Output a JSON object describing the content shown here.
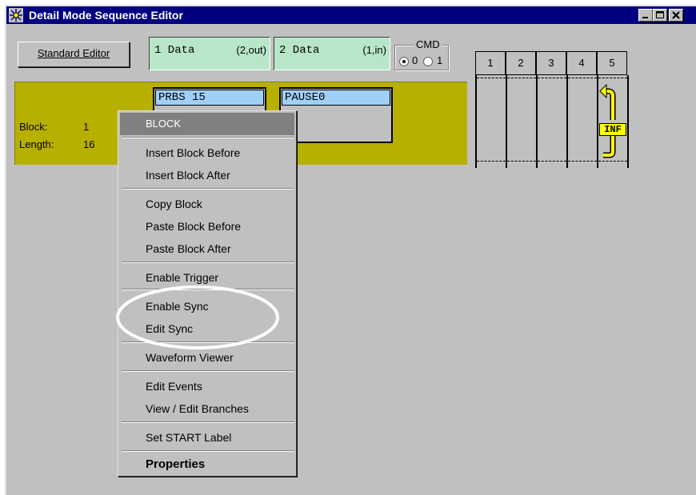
{
  "window": {
    "title": "Detail Mode Sequence Editor",
    "icons": [
      "app-icon",
      "minimize-icon",
      "maximize-icon",
      "close-icon"
    ],
    "colors": {
      "titlebar": "#000080",
      "face": "#c0c0c0"
    }
  },
  "toolbar": {
    "standard_editor_label": "Standard Editor",
    "data1": {
      "name": "1 Data",
      "channel": "(2,out)"
    },
    "data2": {
      "name": "2 Data",
      "channel": "(1,in)"
    },
    "cmd": {
      "legend": "CMD",
      "options": [
        "0",
        "1"
      ],
      "selected": "0"
    }
  },
  "sequence_grid": {
    "columns": [
      "1",
      "2",
      "3",
      "4",
      "5"
    ],
    "loop_label": "INF",
    "loop_color": "#ffff00"
  },
  "block_strip": {
    "color": "#b8b000",
    "block_label": "Block:",
    "block_value": "1",
    "length_label": "Length:",
    "length_value": "16",
    "segments": [
      "PRBS 15",
      "PAUSE0"
    ]
  },
  "context_menu": {
    "header": "BLOCK",
    "items": [
      "Insert Block Before",
      "Insert Block After",
      "Copy Block",
      "Paste Block Before",
      "Paste Block After",
      "Enable Trigger",
      "Enable Sync",
      "Edit Sync",
      "Waveform Viewer",
      "Edit Events",
      "View / Edit Branches",
      "Set START Label",
      "Properties"
    ]
  }
}
